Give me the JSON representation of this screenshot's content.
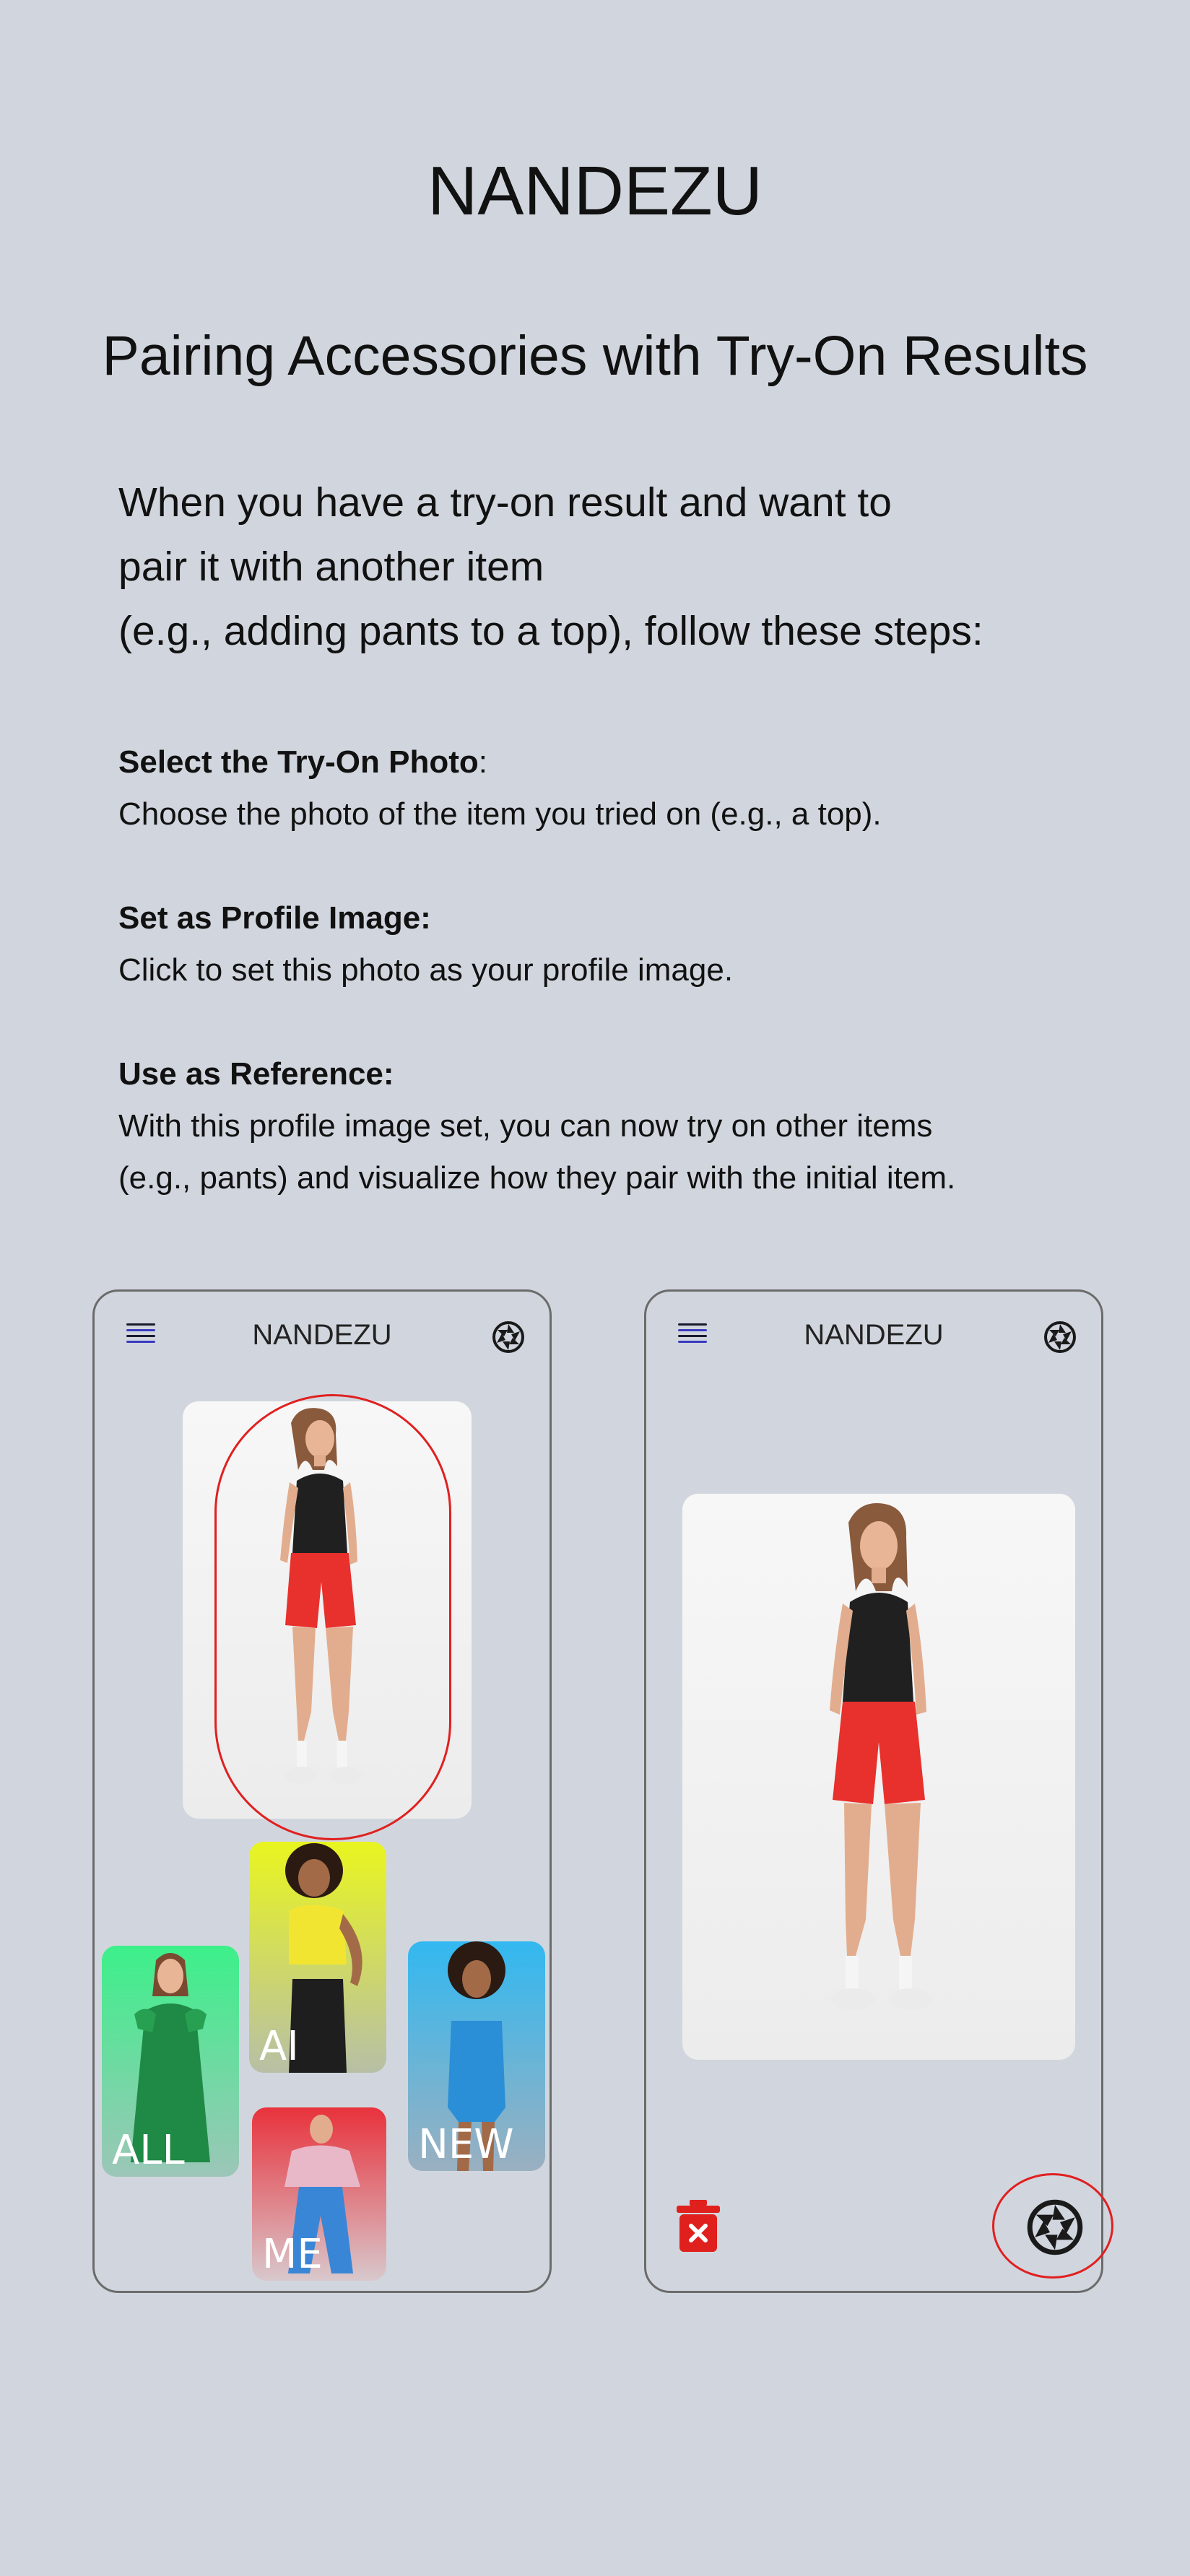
{
  "header": {
    "brand": "NANDEZU",
    "title": "Pairing Accessories with Try-On Results"
  },
  "intro": {
    "line1": "When you have a try-on result and want to",
    "line2": "pair it with another item",
    "line3": "(e.g., adding pants to a top), follow these steps:"
  },
  "steps": [
    {
      "heading": "Select the Try-On Photo",
      "heading_suffix": ":",
      "desc1": " Choose the photo of the item you tried on (e.g., a top).",
      "desc2": ""
    },
    {
      "heading": "Set as Profile Image:",
      "heading_suffix": "",
      "desc1": " Click to set this photo as your profile image.",
      "desc2": ""
    },
    {
      "heading": "Use as Reference:",
      "heading_suffix": "",
      "desc1": "With this profile image set, you can now try on other items",
      "desc2": " (e.g., pants) and visualize how they pair with the initial item."
    }
  ],
  "phone_left": {
    "title": "NANDEZU",
    "menu_icon": "menu-icon",
    "camera_icon": "camera-shutter-icon",
    "tiles": [
      {
        "label": "AI",
        "color_top": "#e9f51f",
        "color_bottom": "#b7bfa6"
      },
      {
        "label": "ALL",
        "color_top": "#3cf08a",
        "color_bottom": "#9cc6b8"
      },
      {
        "label": "NEW",
        "color_top": "#32b8f0",
        "color_bottom": "#9ab0c0"
      },
      {
        "label": "ME",
        "color_top": "#e8323c",
        "color_bottom": "#d8c8cc"
      }
    ]
  },
  "phone_right": {
    "title": "NANDEZU",
    "menu_icon": "menu-icon",
    "camera_icon": "camera-shutter-icon",
    "delete_icon": "trash-icon",
    "delete_color": "#e0201c"
  },
  "colors": {
    "background": "#d1d6de",
    "highlight": "#e02020"
  }
}
